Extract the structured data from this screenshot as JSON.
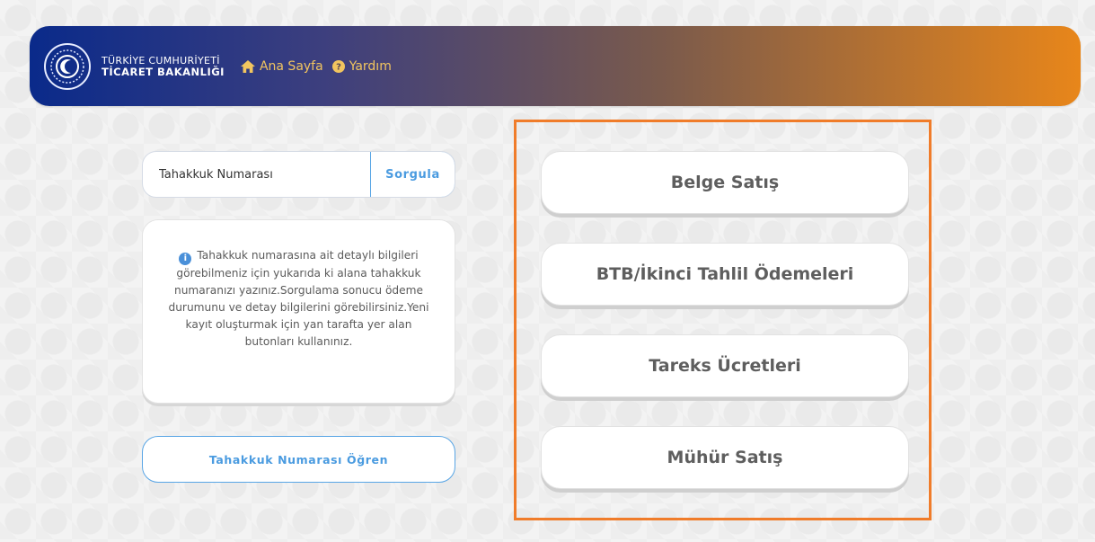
{
  "header": {
    "brand_line1": "TÜRKİYE CUMHURİYETİ",
    "brand_line2": "TİCARET BAKANLIĞI",
    "nav": [
      {
        "label": "Ana Sayfa",
        "icon": "home-icon"
      },
      {
        "label": "Yardım",
        "icon": "help-icon"
      }
    ],
    "gradient_colors": [
      "#0a2a8a",
      "#7a5a4c",
      "#e8861a"
    ],
    "nav_color": "#f2c55f"
  },
  "search": {
    "placeholder": "Tahakkuk Numarası",
    "value": "",
    "button_label": "Sorgula"
  },
  "info": {
    "icon": "info-icon",
    "text": "Tahakkuk numarasına ait detaylı bilgileri görebilmeniz için yukarıda ki alana tahakkuk numaranızı yazınız.Sorgulama sonucu ödeme durumunu ve detay bilgilerini görebilirsiniz.Yeni kayıt oluşturmak için yan tarafta yer alan butonları kullanınız."
  },
  "learn_button": "Tahakkuk Numarası Öğren",
  "actions": [
    "Belge Satış",
    "BTB/İkinci Tahlil Ödemeleri",
    "Tareks Ücretleri",
    "Mühür Satış"
  ],
  "colors": {
    "accent_blue": "#4a9be0",
    "highlight_orange": "#f07c2a"
  }
}
